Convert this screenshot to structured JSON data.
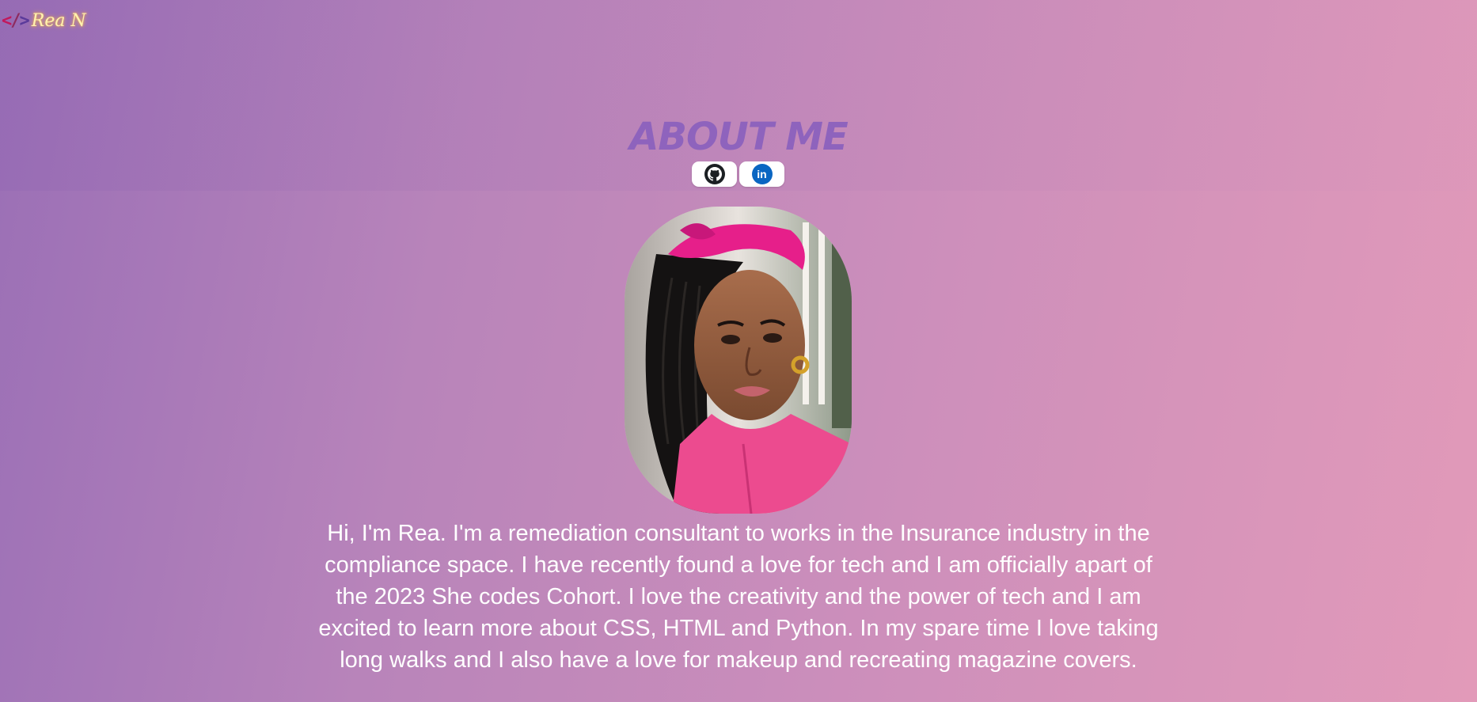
{
  "header": {
    "logo_brackets": {
      "lt": "<",
      "slash": "/",
      "gt": ">"
    },
    "logo_name": "Rea N"
  },
  "main": {
    "title": "About me",
    "social": [
      {
        "name": "github",
        "icon": "github-icon",
        "color": "#1b1f23"
      },
      {
        "name": "linkedin",
        "icon": "linkedin-icon",
        "label": "in",
        "color": "#0a66c2"
      }
    ],
    "portrait": {
      "alt": "Portrait of Rea"
    },
    "bio": "Hi, I'm Rea. I'm a remediation consultant to works in the Insurance industry in the compliance space. I have recently found a love for tech and I am officially apart of the 2023 She codes Cohort. I love the creativity and the power of tech and I am excited to learn more about CSS, HTML and Python. In my spare time I love taking long walks and I also have a love for makeup and recreating magazine covers."
  },
  "colors": {
    "background_start": "#9a6fb6",
    "background_end": "#e29ab9",
    "title": "#8e63bd",
    "logo_accent": "#c2185b",
    "logo_name": "#fff3b0",
    "bio_text": "#ffffff"
  }
}
